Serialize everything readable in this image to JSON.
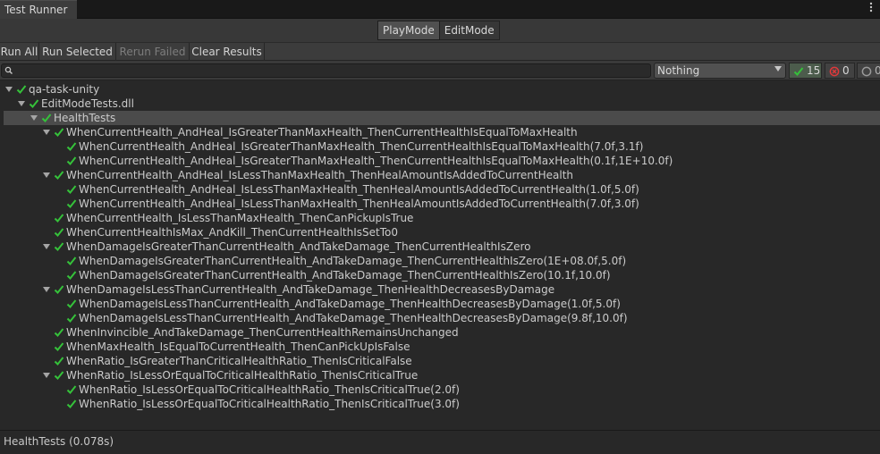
{
  "window": {
    "tab_title": "Test Runner",
    "menu_icon": "kebab-menu-icon"
  },
  "modes": [
    {
      "label": "PlayMode",
      "active": true
    },
    {
      "label": "EditMode",
      "active": false
    }
  ],
  "toolbar": {
    "run_all": "Run All",
    "run_selected": "Run Selected",
    "rerun_failed": "Rerun Failed",
    "clear_results": "Clear Results"
  },
  "filter": {
    "search_value": "",
    "category_selected": "Nothing",
    "passed_count": "15",
    "failed_count": "0",
    "skipped_count": "0"
  },
  "colors": {
    "pass": "#35c23a",
    "fail": "#e0383a",
    "skip": "#9a9a9a",
    "selection": "#4b4b4b"
  },
  "tree": [
    {
      "label": "qa-task-unity",
      "depth": 0,
      "expandable": true
    },
    {
      "label": "EditModeTests.dll",
      "depth": 1,
      "expandable": true
    },
    {
      "label": "HealthTests",
      "depth": 2,
      "expandable": true,
      "selected": true
    },
    {
      "label": "WhenCurrentHealth_AndHeal_IsGreaterThanMaxHealth_ThenCurrentHealthIsEqualToMaxHealth",
      "depth": 3,
      "expandable": true
    },
    {
      "label": "WhenCurrentHealth_AndHeal_IsGreaterThanMaxHealth_ThenCurrentHealthIsEqualToMaxHealth(7.0f,3.1f)",
      "depth": 4,
      "expandable": false
    },
    {
      "label": "WhenCurrentHealth_AndHeal_IsGreaterThanMaxHealth_ThenCurrentHealthIsEqualToMaxHealth(0.1f,1E+10.0f)",
      "depth": 4,
      "expandable": false
    },
    {
      "label": "WhenCurrentHealth_AndHeal_IsLessThanMaxHealth_ThenHealAmountIsAddedToCurrentHealth",
      "depth": 3,
      "expandable": true
    },
    {
      "label": "WhenCurrentHealth_AndHeal_IsLessThanMaxHealth_ThenHealAmountIsAddedToCurrentHealth(1.0f,5.0f)",
      "depth": 4,
      "expandable": false
    },
    {
      "label": "WhenCurrentHealth_AndHeal_IsLessThanMaxHealth_ThenHealAmountIsAddedToCurrentHealth(7.0f,3.0f)",
      "depth": 4,
      "expandable": false
    },
    {
      "label": "WhenCurrentHealth_IsLessThanMaxHealth_ThenCanPickupIsTrue",
      "depth": 3,
      "expandable": false
    },
    {
      "label": "WhenCurrentHealthIsMax_AndKill_ThenCurrentHealthIsSetTo0",
      "depth": 3,
      "expandable": false
    },
    {
      "label": "WhenDamageIsGreaterThanCurrentHealth_AndTakeDamage_ThenCurrentHealthIsZero",
      "depth": 3,
      "expandable": true
    },
    {
      "label": "WhenDamageIsGreaterThanCurrentHealth_AndTakeDamage_ThenCurrentHealthIsZero(1E+08.0f,5.0f)",
      "depth": 4,
      "expandable": false
    },
    {
      "label": "WhenDamageIsGreaterThanCurrentHealth_AndTakeDamage_ThenCurrentHealthIsZero(10.1f,10.0f)",
      "depth": 4,
      "expandable": false
    },
    {
      "label": "WhenDamageIsLessThanCurrentHealth_AndTakeDamage_ThenHealthDecreasesByDamage",
      "depth": 3,
      "expandable": true
    },
    {
      "label": "WhenDamageIsLessThanCurrentHealth_AndTakeDamage_ThenHealthDecreasesByDamage(1.0f,5.0f)",
      "depth": 4,
      "expandable": false
    },
    {
      "label": "WhenDamageIsLessThanCurrentHealth_AndTakeDamage_ThenHealthDecreasesByDamage(9.8f,10.0f)",
      "depth": 4,
      "expandable": false
    },
    {
      "label": "WhenInvincible_AndTakeDamage_ThenCurrentHealthRemainsUnchanged",
      "depth": 3,
      "expandable": false
    },
    {
      "label": "WhenMaxHealth_IsEqualToCurrentHealth_ThenCanPickUpIsFalse",
      "depth": 3,
      "expandable": false
    },
    {
      "label": "WhenRatio_IsGreaterThanCriticalHealthRatio_ThenIsCriticalFalse",
      "depth": 3,
      "expandable": false
    },
    {
      "label": "WhenRatio_IsLessOrEqualToCriticalHealthRatio_ThenIsCriticalTrue",
      "depth": 3,
      "expandable": true
    },
    {
      "label": "WhenRatio_IsLessOrEqualToCriticalHealthRatio_ThenIsCriticalTrue(2.0f)",
      "depth": 4,
      "expandable": false
    },
    {
      "label": "WhenRatio_IsLessOrEqualToCriticalHealthRatio_ThenIsCriticalTrue(3.0f)",
      "depth": 4,
      "expandable": false
    }
  ],
  "status": {
    "text": "HealthTests (0.078s)"
  }
}
